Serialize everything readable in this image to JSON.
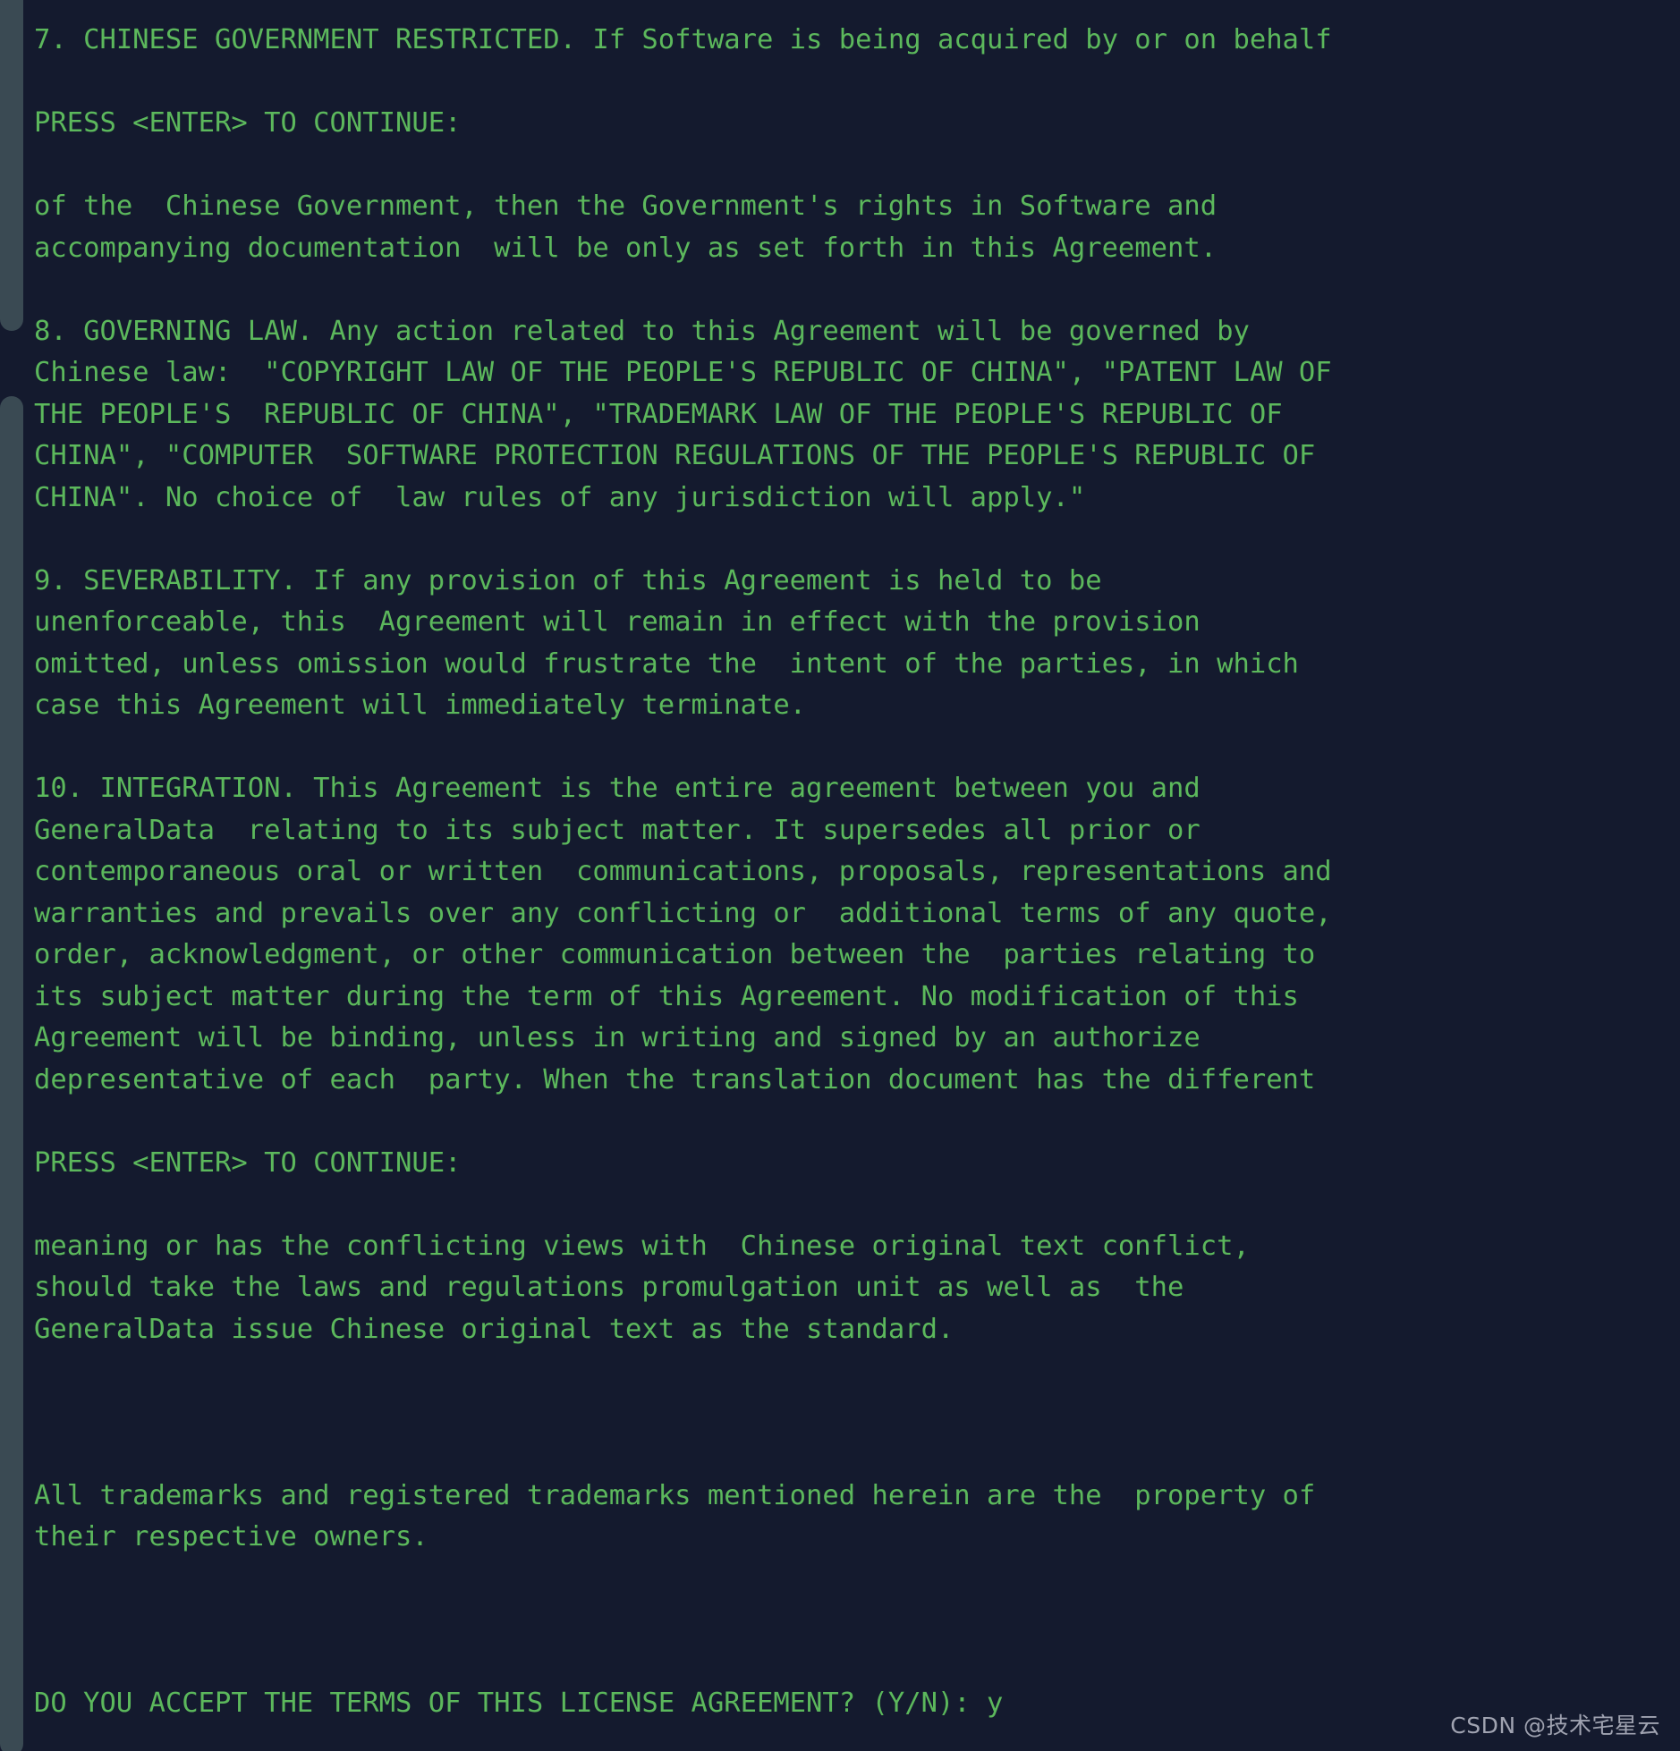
{
  "terminal": {
    "background_color": "#141a2e",
    "text_color": "#5cb85c",
    "scrollbar_color": "#3a4a53",
    "lines": [
      "7. CHINESE GOVERNMENT RESTRICTED. If Software is being acquired by or on behalf",
      "",
      "PRESS <ENTER> TO CONTINUE:",
      "",
      "of the  Chinese Government, then the Government's rights in Software and",
      "accompanying documentation  will be only as set forth in this Agreement.",
      "",
      "8. GOVERNING LAW. Any action related to this Agreement will be governed by",
      "Chinese law:  \"COPYRIGHT LAW OF THE PEOPLE'S REPUBLIC OF CHINA\", \"PATENT LAW OF",
      "THE PEOPLE'S  REPUBLIC OF CHINA\", \"TRADEMARK LAW OF THE PEOPLE'S REPUBLIC OF",
      "CHINA\", \"COMPUTER  SOFTWARE PROTECTION REGULATIONS OF THE PEOPLE'S REPUBLIC OF",
      "CHINA\". No choice of  law rules of any jurisdiction will apply.\"",
      "",
      "9. SEVERABILITY. If any provision of this Agreement is held to be",
      "unenforceable, this  Agreement will remain in effect with the provision",
      "omitted, unless omission would frustrate the  intent of the parties, in which",
      "case this Agreement will immediately terminate.",
      "",
      "10. INTEGRATION. This Agreement is the entire agreement between you and",
      "GeneralData  relating to its subject matter. It supersedes all prior or",
      "contemporaneous oral or written  communications, proposals, representations and",
      "warranties and prevails over any conflicting or  additional terms of any quote,",
      "order, acknowledgment, or other communication between the  parties relating to",
      "its subject matter during the term of this Agreement. No modification of this",
      "Agreement will be binding, unless in writing and signed by an authorize",
      "depresentative of each  party. When the translation document has the different",
      "",
      "PRESS <ENTER> TO CONTINUE:",
      "",
      "meaning or has the conflicting views with  Chinese original text conflict,",
      "should take the laws and regulations promulgation unit as well as  the",
      "GeneralData issue Chinese original text as the standard.",
      "",
      "",
      "",
      "All trademarks and registered trademarks mentioned herein are the  property of",
      "their respective owners.",
      "",
      "",
      "",
      "DO YOU ACCEPT THE TERMS OF THIS LICENSE AGREEMENT? (Y/N): y"
    ],
    "prompts": {
      "press_enter": "PRESS <ENTER> TO CONTINUE:",
      "accept_question": "DO YOU ACCEPT THE TERMS OF THIS LICENSE AGREEMENT? (Y/N):",
      "user_response": "y"
    }
  },
  "watermark": {
    "text": "CSDN @技术宅星云"
  }
}
